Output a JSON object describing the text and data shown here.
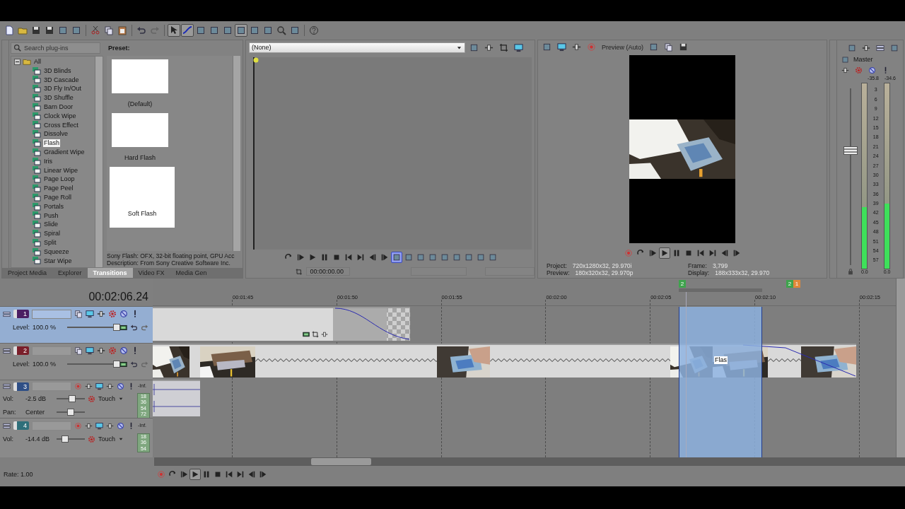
{
  "toolbar": [
    {
      "kind": "document",
      "on": false
    },
    {
      "kind": "folder",
      "on": false
    },
    {
      "kind": "disk",
      "on": false
    },
    {
      "kind": "disk",
      "on": false
    },
    {
      "kind": "square",
      "on": false
    },
    {
      "kind": "square",
      "on": false
    },
    {
      "kind": "scissors",
      "on": false
    },
    {
      "kind": "copy",
      "on": false
    },
    {
      "kind": "clipboard",
      "on": false
    },
    {
      "kind": "undo",
      "on": false
    },
    {
      "kind": "redo",
      "on": false
    },
    {
      "kind": "cursor",
      "on": true
    },
    {
      "kind": "curve",
      "on": true
    },
    {
      "kind": "square",
      "on": false
    },
    {
      "kind": "square",
      "on": false
    },
    {
      "kind": "square",
      "on": false
    },
    {
      "kind": "square",
      "on": true
    },
    {
      "kind": "square",
      "on": false
    },
    {
      "kind": "square",
      "on": false
    },
    {
      "kind": "magnifier",
      "on": false
    },
    {
      "kind": "square",
      "on": false
    },
    {
      "kind": "help",
      "on": false
    }
  ],
  "explorer": {
    "search": {
      "placeholder": "Search plug-ins"
    },
    "tree": [
      {
        "label": "All",
        "expanded": true,
        "children": [
          {
            "label": "3D Blinds",
            "selected": false
          },
          {
            "label": "3D Cascade",
            "selected": false
          },
          {
            "label": "3D Fly In/Out",
            "selected": false
          },
          {
            "label": "3D Shuffle",
            "selected": false
          },
          {
            "label": "Barn Door",
            "selected": false
          },
          {
            "label": "Clock Wipe",
            "selected": false
          },
          {
            "label": "Cross Effect",
            "selected": false
          },
          {
            "label": "Dissolve",
            "selected": false
          },
          {
            "label": "Flash",
            "selected": true
          },
          {
            "label": "Gradient Wipe",
            "selected": false
          },
          {
            "label": "Iris",
            "selected": false
          },
          {
            "label": "Linear Wipe",
            "selected": false
          },
          {
            "label": "Page Loop",
            "selected": false
          },
          {
            "label": "Page Peel",
            "selected": false
          },
          {
            "label": "Page Roll",
            "selected": false
          },
          {
            "label": "Portals",
            "selected": false
          },
          {
            "label": "Push",
            "selected": false
          },
          {
            "label": "Slide",
            "selected": false
          },
          {
            "label": "Spiral",
            "selected": false
          },
          {
            "label": "Split",
            "selected": false
          },
          {
            "label": "Squeeze",
            "selected": false
          },
          {
            "label": "Star Wipe",
            "selected": false
          }
        ]
      }
    ],
    "preset_header": "Preset:",
    "presets": [
      {
        "label": "(Default)"
      },
      {
        "label": "Hard Flash"
      },
      {
        "label": "Soft Flash"
      }
    ],
    "description": [
      "Sony Flash: OFX, 32-bit floating point, GPU Acc",
      "Description: From Sony Creative Software Inc."
    ],
    "tabs": [
      {
        "label": "Project Media",
        "selected": false
      },
      {
        "label": "Explorer",
        "selected": false
      },
      {
        "label": "Transitions",
        "selected": true
      },
      {
        "label": "Video FX",
        "selected": false
      },
      {
        "label": "Media Gen",
        "selected": false
      }
    ]
  },
  "trimmer": {
    "dropdown": "(None)",
    "timecode": "00:00:00.00",
    "transport": [
      {
        "kind": "loop",
        "on": false
      },
      {
        "kind": "play-start",
        "on": false
      },
      {
        "kind": "play",
        "on": false
      },
      {
        "kind": "pause",
        "on": false
      },
      {
        "kind": "stop",
        "on": false
      },
      {
        "kind": "go-start",
        "on": false
      },
      {
        "kind": "go-end",
        "on": false
      },
      {
        "kind": "prev-frame",
        "on": false
      },
      {
        "kind": "next-frame",
        "on": false
      },
      {
        "kind": "square",
        "on": true
      },
      {
        "kind": "square",
        "on": false
      },
      {
        "kind": "square",
        "on": false
      },
      {
        "kind": "square",
        "on": false
      },
      {
        "kind": "square",
        "on": false
      },
      {
        "kind": "square",
        "on": false
      },
      {
        "kind": "square",
        "on": false
      },
      {
        "kind": "square",
        "on": false
      },
      {
        "kind": "square",
        "on": false
      }
    ]
  },
  "preview": {
    "mode": "Preview (Auto)",
    "transport": [
      {
        "kind": "record",
        "on": false
      },
      {
        "kind": "loop",
        "on": false
      },
      {
        "kind": "play-start",
        "on": false
      },
      {
        "kind": "play",
        "on": true
      },
      {
        "kind": "pause",
        "on": false
      },
      {
        "kind": "stop",
        "on": false
      },
      {
        "kind": "go-start",
        "on": false
      },
      {
        "kind": "go-end",
        "on": false
      },
      {
        "kind": "prev-frame",
        "on": false
      },
      {
        "kind": "next-frame",
        "on": false
      }
    ],
    "info": [
      {
        "label": "Project:",
        "value": "720x1280x32, 29.970i"
      },
      {
        "label": "Frame:",
        "value": "3,799"
      },
      {
        "label": "Preview:",
        "value": "180x320x32, 29.970p"
      },
      {
        "label": "Display:",
        "value": "188x333x32, 29.970"
      }
    ]
  },
  "mixer": {
    "title": "Master",
    "peaks": [
      "-35.8",
      "-34.6"
    ],
    "fader": {
      "level": 0.65
    },
    "scale": [
      "3",
      "6",
      "9",
      "12",
      "15",
      "18",
      "21",
      "24",
      "27",
      "30",
      "33",
      "36",
      "39",
      "42",
      "45",
      "48",
      "51",
      "54",
      "57"
    ],
    "meters": [
      {
        "level": 0.33,
        "reading": "0.0"
      },
      {
        "level": 0.35,
        "reading": "0.0"
      }
    ]
  },
  "timeline": {
    "time": "00:02:06.24",
    "markers": [
      {
        "label": "2",
        "color": "#3fa34d"
      },
      {
        "label": "2",
        "color": "#3fa34d"
      },
      {
        "label": "1",
        "color": "#e0883a"
      }
    ],
    "ruler": [
      "00:01:45",
      "00:01:50",
      "00:01:55",
      "00:02:00",
      "00:02:05",
      "00:02:10",
      "00:02:15"
    ],
    "tracks": [
      {
        "kind": "video",
        "number": "1",
        "color": "#4b1f63",
        "selected": true,
        "level": {
          "label": "Level:",
          "value": "100.0 %",
          "level": 1
        }
      },
      {
        "kind": "video",
        "number": "2",
        "color": "#7a1f2a",
        "selected": false,
        "level": {
          "label": "Level:",
          "value": "100.0 %",
          "level": 1
        },
        "transition_label": "Flas"
      },
      {
        "kind": "audio",
        "number": "3",
        "color": "#2f4f86",
        "selected": false,
        "vol": {
          "label": "Vol:",
          "value": "-2.5 dB",
          "level": 0.55
        },
        "pan": {
          "label": "Pan:",
          "value": "Center",
          "level": 0.5
        },
        "mode": "Touch",
        "meter_peak": "-Inf.",
        "meter_scale": [
          "18",
          "36",
          "54",
          "72"
        ]
      },
      {
        "kind": "audio",
        "number": "4",
        "color": "#2f6f7a",
        "selected": false,
        "vol": {
          "label": "Vol:",
          "value": "-14.4 dB",
          "level": 0.3
        },
        "mode": "Touch",
        "meter_peak": "-Inf.",
        "meter_scale": [
          "18",
          "36",
          "54"
        ]
      }
    ],
    "rate": "Rate: 1.00",
    "transport": [
      {
        "kind": "record",
        "on": false
      },
      {
        "kind": "loop",
        "on": false
      },
      {
        "kind": "play-start",
        "on": false
      },
      {
        "kind": "play",
        "on": true
      },
      {
        "kind": "pause",
        "on": false
      },
      {
        "kind": "stop",
        "on": false
      },
      {
        "kind": "go-start",
        "on": false
      },
      {
        "kind": "go-end",
        "on": false
      },
      {
        "kind": "prev-frame",
        "on": false
      },
      {
        "kind": "next-frame",
        "on": false
      }
    ]
  }
}
